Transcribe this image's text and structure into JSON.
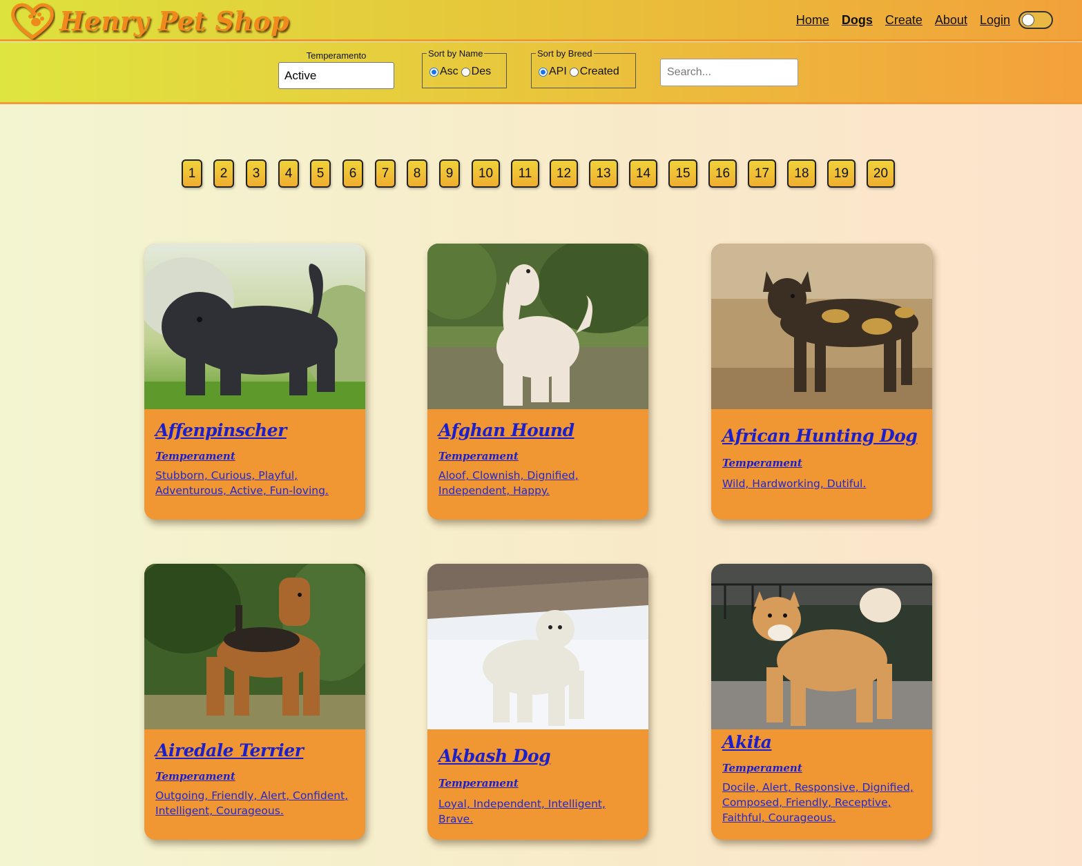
{
  "brand": {
    "name": "Henry Pet Shop"
  },
  "nav": {
    "home": "Home",
    "dogs": "Dogs",
    "create": "Create",
    "about": "About",
    "login": "Login"
  },
  "filters": {
    "temperament_label": "Temperamento",
    "temperament_value": "Active",
    "sort_name": {
      "legend": "Sort by Name",
      "asc": "Asc",
      "des": "Des",
      "selected": "Asc"
    },
    "sort_breed": {
      "legend": "Sort by Breed",
      "api": "API",
      "created": "Created",
      "selected": "API"
    },
    "search_placeholder": "Search..."
  },
  "pagination": [
    "1",
    "2",
    "3",
    "4",
    "5",
    "6",
    "7",
    "8",
    "9",
    "10",
    "11",
    "12",
    "13",
    "14",
    "15",
    "16",
    "17",
    "18",
    "19",
    "20"
  ],
  "cards": [
    {
      "name": "Affenpinscher",
      "temp_title": "Temperament",
      "temperaments": "Stubborn, Curious, Playful, Adventurous, Active, Fun-loving."
    },
    {
      "name": "Afghan Hound",
      "temp_title": "Temperament",
      "temperaments": "Aloof, Clownish, Dignified, Independent, Happy."
    },
    {
      "name": "African Hunting Dog",
      "temp_title": "Temperament",
      "temperaments": "Wild, Hardworking, Dutiful."
    },
    {
      "name": "Airedale Terrier",
      "temp_title": "Temperament",
      "temperaments": "Outgoing, Friendly, Alert, Confident, Intelligent, Courageous."
    },
    {
      "name": "Akbash Dog",
      "temp_title": "Temperament",
      "temperaments": "Loyal, Independent, Intelligent, Brave."
    },
    {
      "name": "Akita",
      "temp_title": "Temperament",
      "temperaments": "Docile, Alert, Responsive, Dignified, Composed, Friendly, Receptive, Faithful, Courageous."
    }
  ],
  "colors": {
    "accent": "#f09632",
    "link": "#1d20c9",
    "header_start": "#dde23c",
    "header_end": "#f2a13a"
  }
}
